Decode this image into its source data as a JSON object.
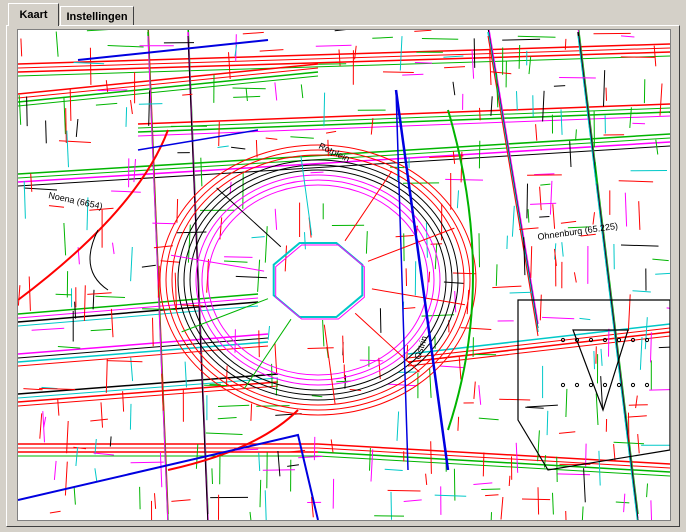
{
  "tabs": [
    {
      "label": "Kaart",
      "active": true
    },
    {
      "label": "Instellingen",
      "active": false
    }
  ],
  "map": {
    "labels": [
      {
        "text": "Rotplein"
      },
      {
        "text": "Noena (6654)"
      },
      {
        "text": "Ohnenburg (65.225)"
      },
      {
        "text": "Ostrin"
      }
    ],
    "colors": {
      "red": "#ff0000",
      "green": "#00b400",
      "blue": "#0000e0",
      "magenta": "#ff00ff",
      "black": "#000000",
      "cyan": "#00c8c8"
    }
  }
}
